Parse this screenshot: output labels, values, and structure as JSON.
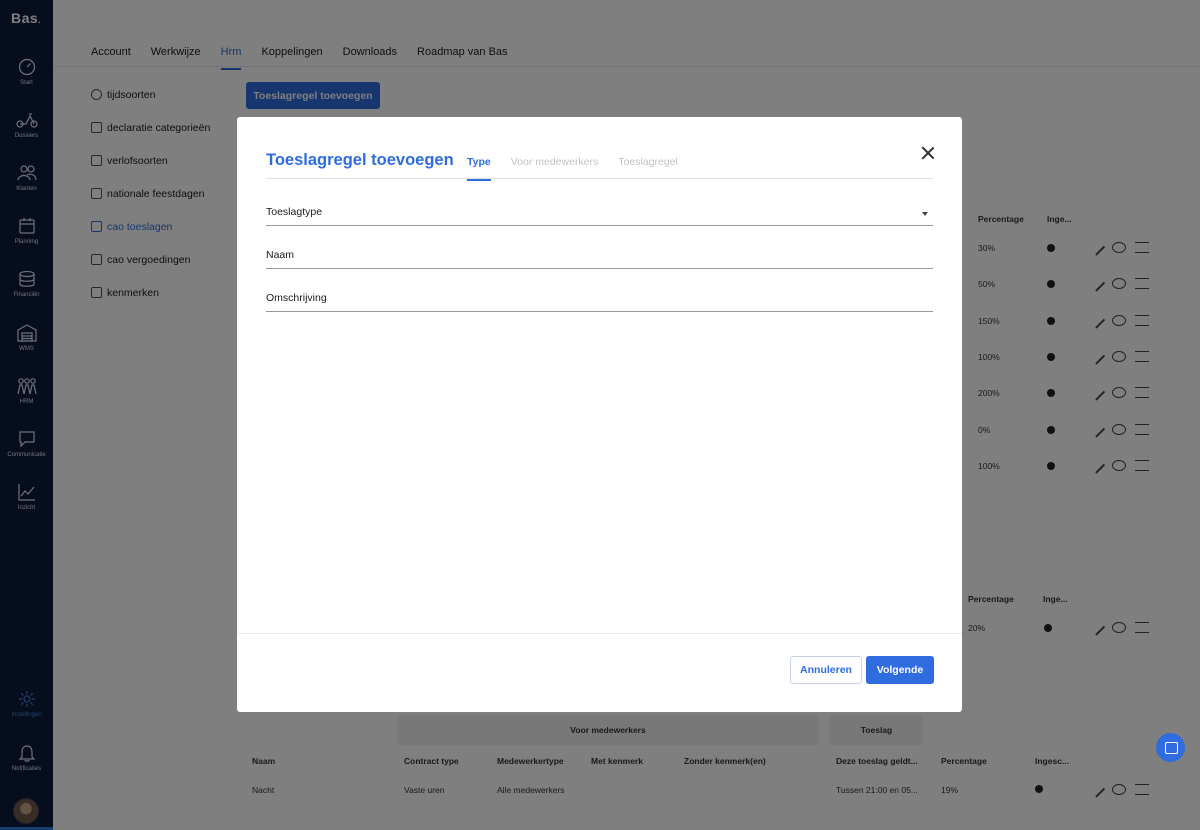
{
  "sidebar": {
    "logo": "Bas",
    "items": [
      {
        "label": "Start",
        "icon": "speedometer-icon"
      },
      {
        "label": "Dossiers",
        "icon": "scooter-icon"
      },
      {
        "label": "Klanten",
        "icon": "users-icon"
      },
      {
        "label": "Planning",
        "icon": "calendar-icon"
      },
      {
        "label": "Financiën",
        "icon": "coins-icon"
      },
      {
        "label": "WMS",
        "icon": "warehouse-icon"
      },
      {
        "label": "HRM",
        "icon": "team-icon"
      },
      {
        "label": "Communicatie",
        "icon": "chat-icon"
      },
      {
        "label": "Inzicht",
        "icon": "chart-icon"
      }
    ],
    "settings": {
      "label": "Instellingen",
      "icon": "gear-icon"
    },
    "notifications": {
      "label": "Notificaties",
      "icon": "bell-icon"
    }
  },
  "top_tabs": [
    "Account",
    "Werkwijze",
    "Hrm",
    "Koppelingen",
    "Downloads",
    "Roadmap van Bas"
  ],
  "active_tab": "Hrm",
  "side_menu": [
    {
      "label": "tijdsoorten",
      "icon": "clock-icon"
    },
    {
      "label": "declaratie categorieën",
      "icon": "money-icon"
    },
    {
      "label": "verlofsoorten",
      "icon": "hourglass-icon"
    },
    {
      "label": "nationale feestdagen",
      "icon": "tent-icon"
    },
    {
      "label": "cao toeslagen",
      "icon": "percent-icon"
    },
    {
      "label": "cao vergoedingen",
      "icon": "car-icon"
    },
    {
      "label": "kenmerken",
      "icon": "people-icon"
    }
  ],
  "add_button": "Toeslagregel toevoegen",
  "table1": {
    "headers": {
      "percentage": "Percentage",
      "ingesteld": "Inge..."
    },
    "rows": [
      "30%",
      "50%",
      "150%",
      "100%",
      "200%",
      "0%",
      "100%"
    ]
  },
  "table2": {
    "headers": {
      "percentage": "Percentage",
      "ingesteld": "Inge..."
    },
    "rows": [
      "20%"
    ]
  },
  "table3": {
    "bands": {
      "medewerkers": "Voor medewerkers",
      "toeslag": "Toeslag"
    },
    "headers": [
      "Naam",
      "Contract type",
      "Medewerkertype",
      "Met kenmerk",
      "Zonder kenmerk(en)",
      "Deze toeslag geldt...",
      "Percentage",
      "Ingesc..."
    ],
    "row": {
      "naam": "Nacht",
      "contract": "Vaste uren",
      "medewerkertype": "Alle medewerkers",
      "geldt": "Tussen 21:00 en 05...",
      "percentage": "19%"
    }
  },
  "modal": {
    "title": "Toeslagregel toevoegen",
    "tabs": [
      "Type",
      "Voor medewerkers",
      "Toeslagregel"
    ],
    "active_tab": "Type",
    "fields": {
      "type_label": "Toeslagtype",
      "name_label": "Naam",
      "description_label": "Omschrijving"
    },
    "cancel": "Annuleren",
    "next": "Volgende"
  },
  "colors": {
    "primary": "#2e6cdf",
    "sidebar": "#0c1a3a"
  }
}
